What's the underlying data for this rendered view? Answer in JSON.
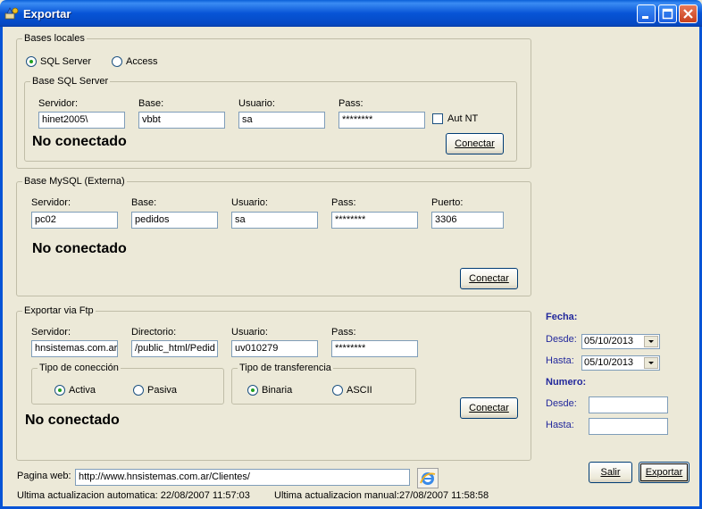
{
  "window": {
    "title": "Exportar"
  },
  "bases_locales": {
    "legend": "Bases locales",
    "radio_sql": "SQL Server",
    "radio_access": "Access",
    "sql_group_legend": "Base SQL Server",
    "labels": {
      "servidor": "Servidor:",
      "base": "Base:",
      "usuario": "Usuario:",
      "pass": "Pass:"
    },
    "values": {
      "servidor": "hinet2005\\",
      "base": "vbbt",
      "usuario": "sa",
      "pass": "********"
    },
    "aut_nt": "Aut NT",
    "status": "No conectado",
    "connect_label": "Conectar"
  },
  "mysql": {
    "legend": "Base MySQL (Externa)",
    "labels": {
      "servidor": "Servidor:",
      "base": "Base:",
      "usuario": "Usuario:",
      "pass": "Pass:",
      "puerto": "Puerto:"
    },
    "values": {
      "servidor": "pc02",
      "base": "pedidos",
      "usuario": "sa",
      "pass": "********",
      "puerto": "3306"
    },
    "status": "No conectado",
    "connect_label": "Conectar"
  },
  "ftp": {
    "legend": "Exportar via Ftp",
    "labels": {
      "servidor": "Servidor:",
      "directorio": "Directorio:",
      "usuario": "Usuario:",
      "pass": "Pass:"
    },
    "values": {
      "servidor": "hnsistemas.com.ar",
      "directorio": "/public_html/Pedid",
      "usuario": "uv010279",
      "pass": "********"
    },
    "tipo_conexion": {
      "legend": "Tipo de conección",
      "activa": "Activa",
      "pasiva": "Pasiva"
    },
    "tipo_transferencia": {
      "legend": "Tipo de transferencia",
      "binaria": "Binaria",
      "ascii": "ASCII"
    },
    "status": "No conectado",
    "connect_label": "Conectar"
  },
  "filters": {
    "fecha_title": "Fecha:",
    "desde_label": "Desde:",
    "hasta_label": "Hasta:",
    "fecha_desde": "05/10/2013",
    "fecha_hasta": "05/10/2013",
    "numero_title": "Numero:",
    "numero_desde_label": "Desde:",
    "numero_hasta_label": "Hasta:",
    "numero_desde": "",
    "numero_hasta": ""
  },
  "footer": {
    "web_label": "Pagina web:",
    "web_value": "http://www.hnsistemas.com.ar/Clientes/",
    "auto_update": "Ultima actualizacion automatica: 22/08/2007 11:57:03",
    "manual_update": "Ultima actualizacion manual:27/08/2007 11:58:58",
    "salir_label": "Salir",
    "exportar_label": "Exportar"
  },
  "colors": {
    "titlebar": "#0754d6",
    "face": "#ece9d8",
    "label_blue": "#22289c"
  }
}
